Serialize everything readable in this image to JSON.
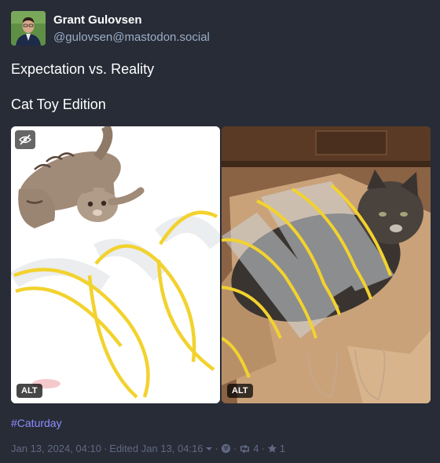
{
  "author": {
    "display_name": "Grant Gulovsen",
    "handle": "@gulovsen@mastodon.social"
  },
  "status": {
    "line1": "Expectation vs. Reality",
    "line2": "Cat Toy Edition",
    "hashtag": "#Caturday"
  },
  "media": {
    "left_alt_label": "ALT",
    "right_alt_label": "ALT"
  },
  "meta": {
    "date": "Jan 13, 2024, 04:10",
    "sep1": "·",
    "edited": "Edited Jan 13, 04:16",
    "sep2": "·",
    "sep3": "·",
    "boost_count": "4",
    "sep4": "·",
    "fav_count": "1"
  },
  "icons": {
    "hide": "eye-slash-icon",
    "edit_dropdown": "caret-down-icon",
    "visibility": "globe-icon",
    "boost": "retweet-icon",
    "favourite": "star-icon"
  },
  "colors": {
    "background": "#282c37",
    "secondary_text": "#9baec8",
    "hashtag": "#8c8dff",
    "meta_text": "#606984",
    "toy_yellow": "#f2d22e"
  }
}
